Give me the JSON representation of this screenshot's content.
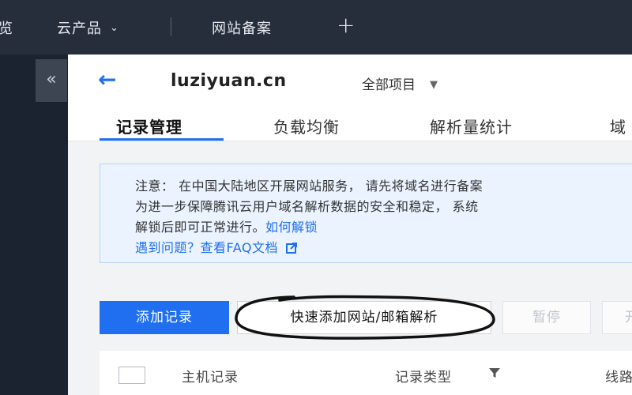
{
  "topnav": {
    "overview_label": "览",
    "cloud_products_label": "云产品",
    "caret": "⌄",
    "beian_label": "网站备案",
    "plus": "+"
  },
  "sidebar": {
    "collapse_label": "«"
  },
  "header": {
    "back": "←",
    "domain": "luziyuan.cn",
    "project_label": "全部项目",
    "project_caret": "▼"
  },
  "tabs": [
    {
      "label": "记录管理",
      "active": true
    },
    {
      "label": "负载均衡",
      "active": false
    },
    {
      "label": "解析量统计",
      "active": false
    },
    {
      "label": "域",
      "active": false
    }
  ],
  "notice": {
    "line1": "注意：  在中国大陆地区开展网站服务，  请先将域名进行备案",
    "line2": "为进一步保障腾讯云用户域名解析数据的安全和稳定，  系统",
    "line3_text": "解锁后即可正常进行。",
    "line3_link": "如何解锁",
    "line4_text": "遇到问题？",
    "line4_link": "查看FAQ文档"
  },
  "toolbar": {
    "add_record": "添加记录",
    "quick_add": "快速添加网站/邮箱解析",
    "pause": "暂停",
    "enable_partial": "开"
  },
  "table": {
    "columns": [
      {
        "label": "主机记录"
      },
      {
        "label": "记录类型"
      },
      {
        "label": "线路"
      }
    ]
  },
  "colors": {
    "accent": "#1f6ff0",
    "topnav_bg": "#262d3b",
    "notice_bg": "#eaf3ff"
  }
}
